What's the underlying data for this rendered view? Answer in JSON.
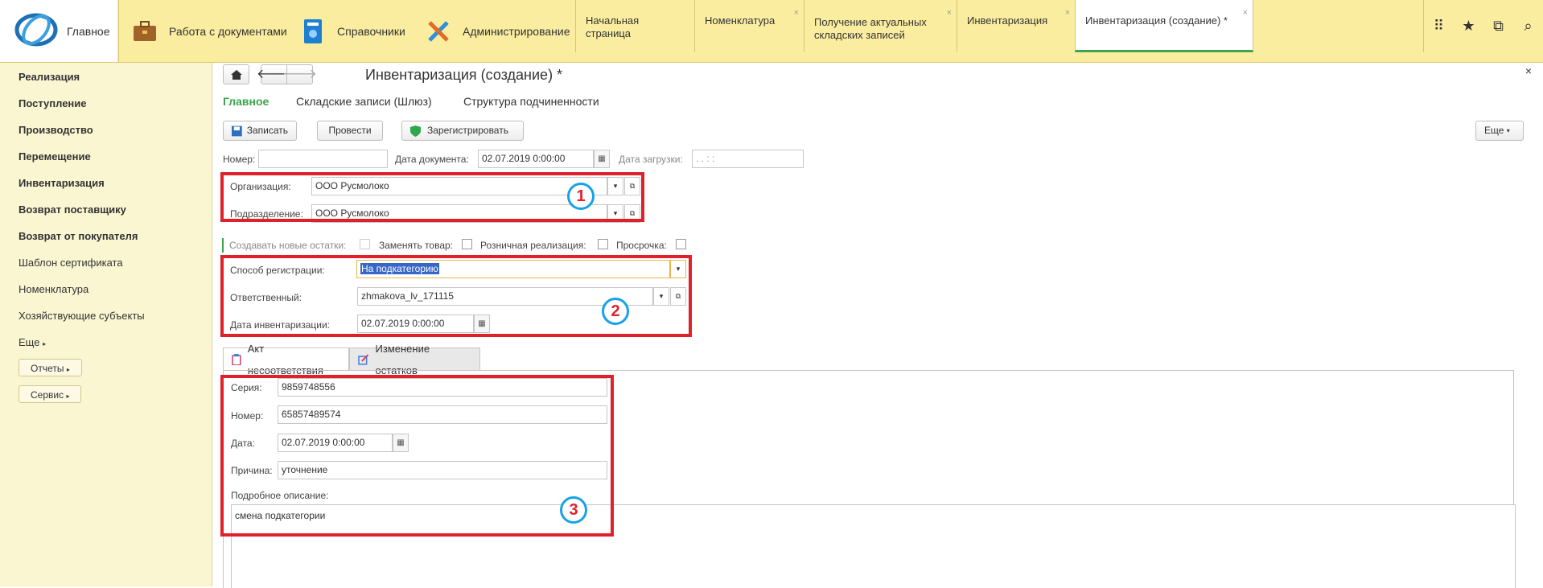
{
  "topbar": {
    "sections": [
      {
        "label": "Главное",
        "icon": "logo-icon"
      },
      {
        "label": "Работа с документами",
        "icon": "briefcase-icon"
      },
      {
        "label": "Справочники",
        "icon": "book-icon"
      },
      {
        "label": "Администрирование",
        "icon": "tools-icon"
      }
    ],
    "tabs": [
      {
        "label": "Начальная страница",
        "closable": false
      },
      {
        "label": "Номенклатура",
        "closable": true
      },
      {
        "label": "Получение актуальных складских записей",
        "closable": true
      },
      {
        "label": "Инвентаризация",
        "closable": true
      },
      {
        "label": "Инвентаризация (создание) *",
        "closable": true
      }
    ],
    "close_glyph": "×",
    "right_icons": [
      "grid-icon",
      "star-icon",
      "history-icon",
      "search-icon"
    ]
  },
  "sidebar": {
    "items": [
      {
        "label": "Реализация",
        "bold": true
      },
      {
        "label": "Поступление",
        "bold": true
      },
      {
        "label": "Производство",
        "bold": true
      },
      {
        "label": "Перемещение",
        "bold": true
      },
      {
        "label": "Инвентаризация",
        "bold": true
      },
      {
        "label": "Возврат поставщику",
        "bold": true
      },
      {
        "label": "Возврат от покупателя",
        "bold": true
      },
      {
        "label": "Шаблон сертификата",
        "bold": false
      },
      {
        "label": "Номенклатура",
        "bold": false
      },
      {
        "label": "Хозяйствующие субъекты",
        "bold": false
      },
      {
        "label": "Еще",
        "bold": false
      }
    ],
    "buttons": [
      "Отчеты",
      "Сервис"
    ]
  },
  "form": {
    "title": "Инвентаризация (создание) *",
    "close_glyph": "×",
    "tabs": [
      "Главное",
      "Складские записи (Шлюз)",
      "Структура подчиненности"
    ],
    "toolbar": {
      "save": "Записать",
      "post": "Провести",
      "register": "Зарегистрировать",
      "more": "Еще"
    },
    "number_label": "Номер:",
    "number_value": "",
    "doc_date_label": "Дата документа:",
    "doc_date_value": "02.07.2019  0:00:00",
    "load_date_label": "Дата загрузки:",
    "load_date_value": " .  .      :  :",
    "org_label": "Организация:",
    "org_value": "ООО Русмолоко",
    "dept_label": "Подразделение:",
    "dept_value": "ООО Русмолоко",
    "checkboxes": [
      {
        "label": "Создавать новые остатки:",
        "disabled": true
      },
      {
        "label": "Заменять товар:",
        "disabled": false
      },
      {
        "label": "Розничная реализация:",
        "disabled": false
      },
      {
        "label": "Просрочка:",
        "disabled": false
      }
    ],
    "reg_method_label": "Способ регистрации:",
    "reg_method_value": "На подкатегорию",
    "responsible_label": "Ответственный:",
    "responsible_value": "zhmakova_lv_171115",
    "inv_date_label": "Дата инвентаризации:",
    "inv_date_value": "02.07.2019  0:00:00",
    "subtabs": [
      "Акт несоответствия",
      "Изменение остатков"
    ],
    "act": {
      "series_label": "Серия:",
      "series_value": "9859748556",
      "number_label": "Номер:",
      "number_value": "65857489574",
      "date_label": "Дата:",
      "date_value": "02.07.2019  0:00:00",
      "reason_label": "Причина:",
      "reason_value": "уточнение",
      "desc_label": "Подробное описание:",
      "desc_value": "смена подкатегории"
    }
  },
  "annotations": [
    "1",
    "2",
    "3"
  ],
  "colors": {
    "topbar": "#fbeda0",
    "sidebar": "#fbf6d2",
    "accent": "#3aa54a",
    "highlight": "#e0202a",
    "badge_border": "#18a1e8"
  }
}
